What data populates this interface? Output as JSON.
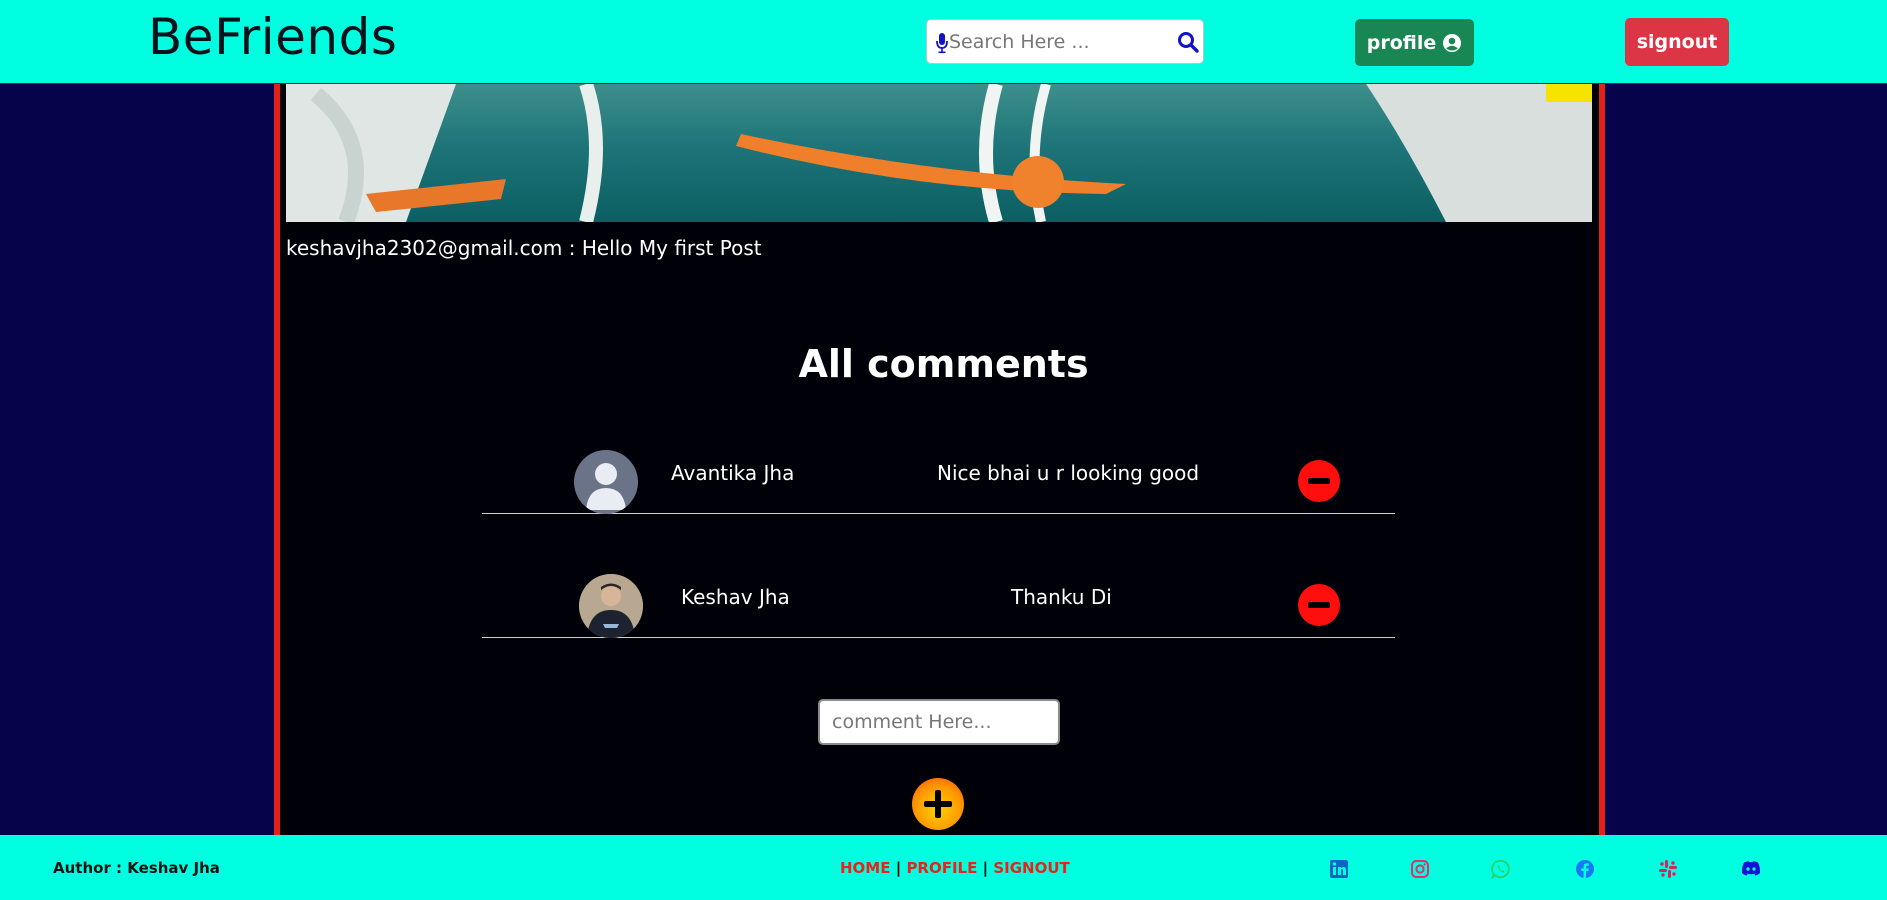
{
  "header": {
    "brand": "BeFriends",
    "search_placeholder": "Search Here ...",
    "profile_label": "profile",
    "signout_label": "signout"
  },
  "post": {
    "caption": "keshavjha2302@gmail.com : Hello My first Post"
  },
  "comments": {
    "title": "All comments",
    "items": [
      {
        "name": "Avantika Jha",
        "text": "Nice bhai u r looking good"
      },
      {
        "name": "Keshav Jha",
        "text": "Thanku Di"
      }
    ],
    "input_placeholder": "comment Here..."
  },
  "footer": {
    "author": "Author : Keshav Jha",
    "links": [
      "HOME",
      "PROFILE",
      "SIGNOUT"
    ],
    "separator": "|",
    "social_icons": [
      "linkedin-icon",
      "instagram-icon",
      "whatsapp-icon",
      "facebook-icon",
      "slack-icon",
      "discord-icon"
    ]
  },
  "colors": {
    "header_bg": "#00ffe0",
    "page_bg": "#05034a",
    "panel_border": "#e5201a",
    "profile_btn": "#198754",
    "signout_btn": "#dc3545",
    "delete_btn": "#ff0e0e"
  }
}
